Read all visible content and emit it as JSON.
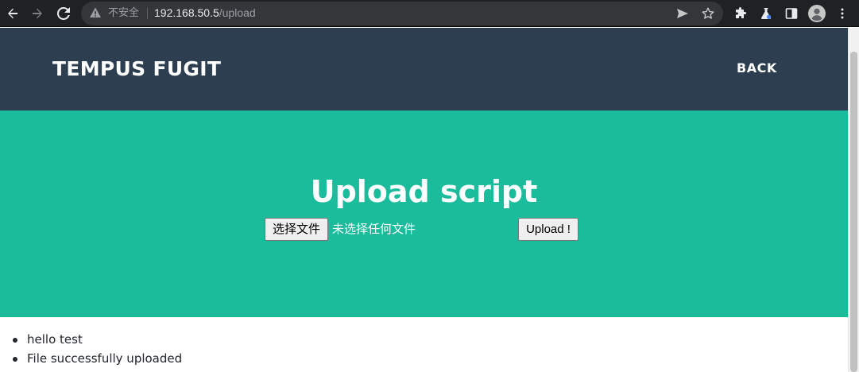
{
  "browser": {
    "security_label": "不安全",
    "url_host": "192.168.50.5",
    "url_path": "/upload",
    "icons": {
      "back": "back-arrow-icon",
      "forward": "forward-arrow-icon",
      "reload": "reload-icon",
      "warning": "warning-triangle-icon",
      "send": "send-icon",
      "bookmark": "star-icon",
      "extensions": "puzzle-icon",
      "labs": "flask-icon",
      "sidepanel": "side-panel-icon",
      "profile": "profile-avatar-icon",
      "menu": "kebab-menu-icon"
    }
  },
  "site": {
    "brand": "TEMPUS FUGIT",
    "back_link": "BACK",
    "colors": {
      "navbar": "#2c3e50",
      "hero": "#1abc9c"
    }
  },
  "hero": {
    "title": "Upload script",
    "file_button_label": "选择文件",
    "file_status": "未选择任何文件",
    "upload_button_label": "Upload !"
  },
  "messages": [
    "hello test",
    "File successfully uploaded"
  ]
}
